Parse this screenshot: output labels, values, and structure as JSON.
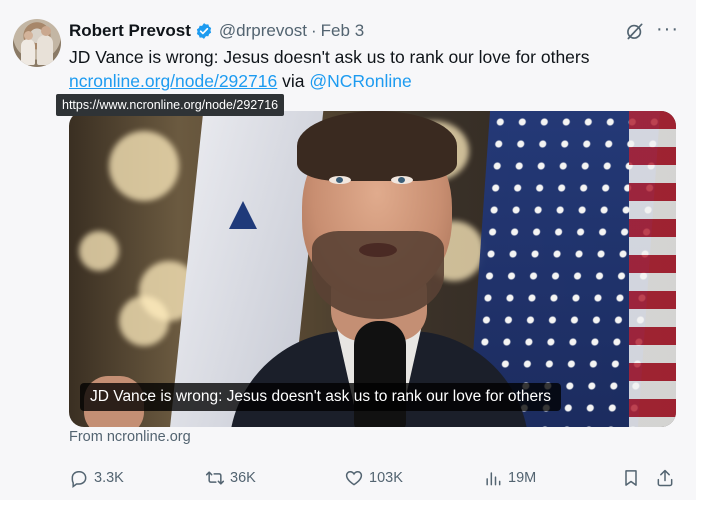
{
  "tweet": {
    "author_name": "Robert Prevost",
    "handle": "@drprevost",
    "separator": "·",
    "date": "Feb 3",
    "text_main": "JD Vance is wrong: Jesus doesn't ask us to rank our love for others",
    "link_text": "ncronline.org/node/292716",
    "via_text": " via ",
    "mention": "@NCRonline",
    "tooltip_url": "https://www.ncronline.org/node/292716",
    "more_icon": "···"
  },
  "media": {
    "caption": "JD Vance is wrong: Jesus doesn't ask us to rank our love for others",
    "source": "From ncronline.org"
  },
  "actions": {
    "replies": "3.3K",
    "reposts": "36K",
    "likes": "103K",
    "views": "19M"
  },
  "icons": {
    "verified": "verified-badge-icon",
    "grok": "grok-icon",
    "more": "more-icon",
    "reply": "reply-icon",
    "repost": "repost-icon",
    "like": "heart-icon",
    "views": "analytics-icon",
    "bookmark": "bookmark-icon",
    "share": "share-icon"
  },
  "colors": {
    "accent": "#1d9bf0",
    "muted": "#536471",
    "text": "#0f1419"
  }
}
